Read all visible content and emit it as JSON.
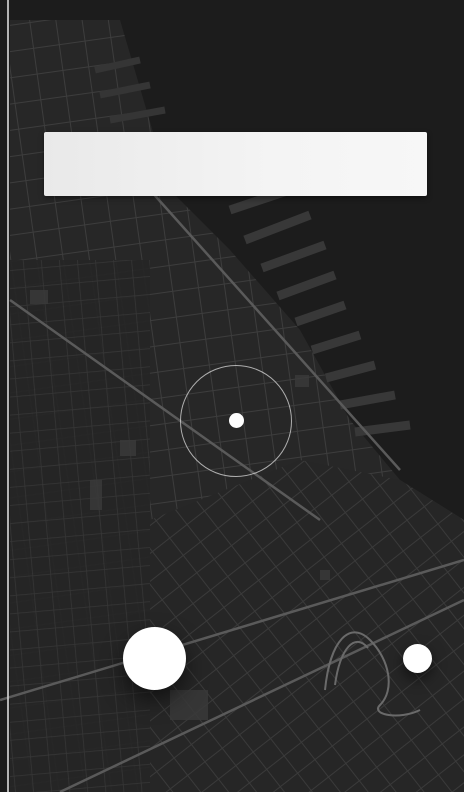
{
  "search": {
    "value": "",
    "placeholder": ""
  },
  "map": {
    "theme": "dark",
    "background_color": "#232323",
    "street_color": "#4a4a4a",
    "water_color": "#1a1a1a"
  },
  "controls": {
    "primary_button_icon": "circle-button",
    "secondary_button_icon": "circle-button",
    "location_marker_icon": "current-location-icon"
  },
  "colors": {
    "accent": "#ffffff",
    "search_bar": "#efefef"
  }
}
